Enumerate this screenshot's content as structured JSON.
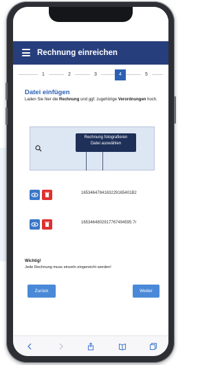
{
  "header": {
    "title": "Rechnung einreichen"
  },
  "steps": {
    "items": [
      {
        "label": "1",
        "active": false
      },
      {
        "label": "2",
        "active": false
      },
      {
        "label": "3",
        "active": false
      },
      {
        "label": "4",
        "active": true
      },
      {
        "label": "5",
        "active": false
      }
    ]
  },
  "section": {
    "title": "Datei einfügen",
    "description_part1": "Laden Sie hier die ",
    "description_bold1": "Rechnung",
    "description_part2": " und ggf. zugehörige ",
    "description_bold2": "Verordnungen",
    "description_part3": " hoch."
  },
  "upload": {
    "option_photo": "Rechnung fotografieren",
    "option_file": "Datei auswählen"
  },
  "files": [
    {
      "id": "1653464784163229165401B2"
    },
    {
      "id": "1653464802917767494595 7r"
    }
  ],
  "notice": {
    "title": "Wichtig!",
    "text": "Jede Rechnung muss einzeln eingereicht werden!"
  },
  "buttons": {
    "back": "Zurück",
    "next": "Weiter"
  },
  "colors": {
    "header": "#273e7c",
    "accent": "#2b61b3",
    "button": "#4a89d8",
    "delete": "#e03131",
    "view": "#3a77c8"
  },
  "bottom_bar": {
    "icons": [
      "back-icon",
      "forward-icon",
      "share-icon",
      "bookmarks-icon",
      "tabs-icon"
    ]
  }
}
